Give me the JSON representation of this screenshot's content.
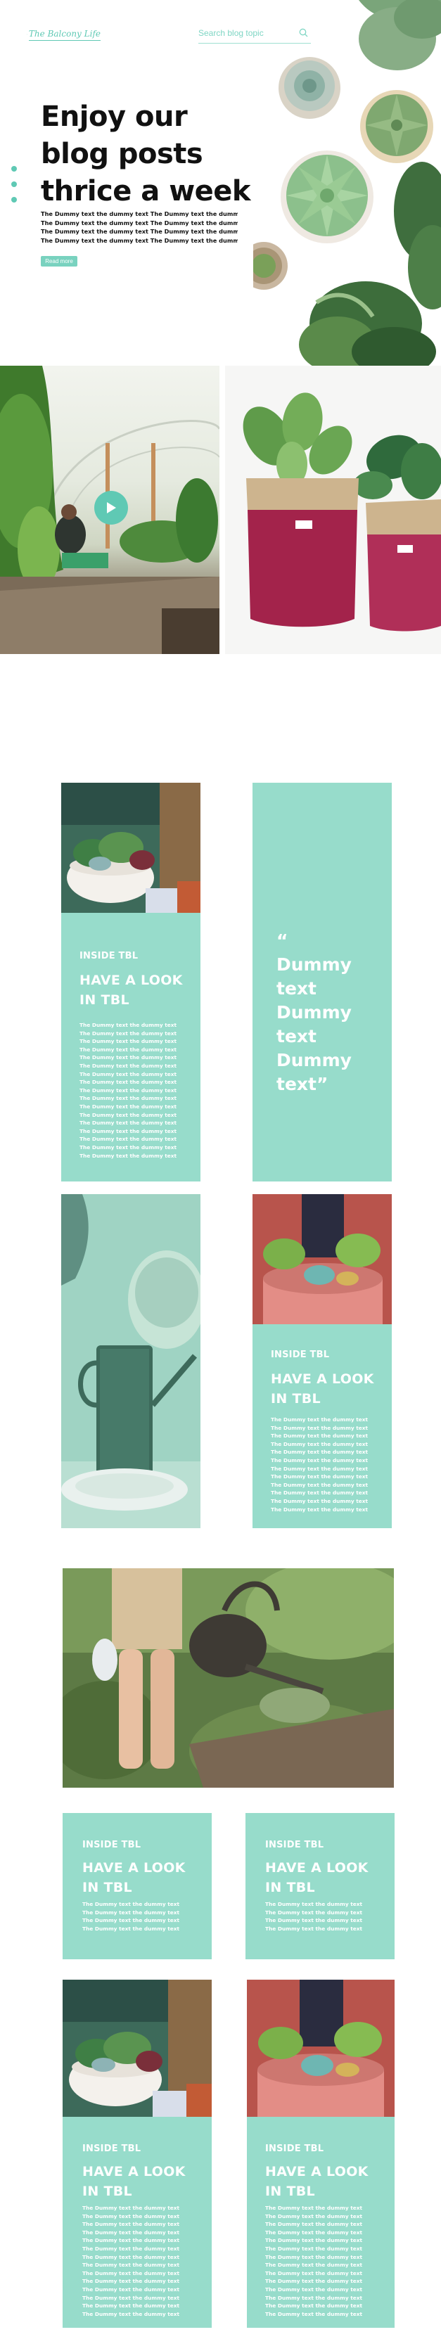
{
  "header": {
    "logo_text": "The Balcony Life",
    "search_placeholder": "Search blog topic"
  },
  "hero": {
    "title_lines": [
      "Enjoy our",
      "blog posts",
      "thrice a week"
    ],
    "body_lines": [
      "The Dummy text the dummy text  The Dummy text the dummy text",
      "The Dummy text the dummy text  The Dummy text the dummy text",
      "The Dummy text the dummy text  The Dummy text the dummy text",
      "The Dummy text the dummy text  The Dummy text the dummy text"
    ],
    "read_more_label": "Read more",
    "slider_dots": 3
  },
  "cards": {
    "inside_label": "INSIDE TBL",
    "heading_line1": "HAVE A LOOK",
    "heading_line2": "IN TBL",
    "dummy_line": "The Dummy text the dummy text"
  },
  "quote": {
    "lines": [
      "“",
      "Dummy",
      "text",
      "Dummy",
      "text",
      "Dummy",
      "text”"
    ]
  },
  "colors": {
    "accent": "#5fc9b4",
    "card_mint": "#97dccb",
    "text_dark": "#111111"
  },
  "icons": [
    "search-icon",
    "play-icon",
    "logo-gardener-icon"
  ]
}
